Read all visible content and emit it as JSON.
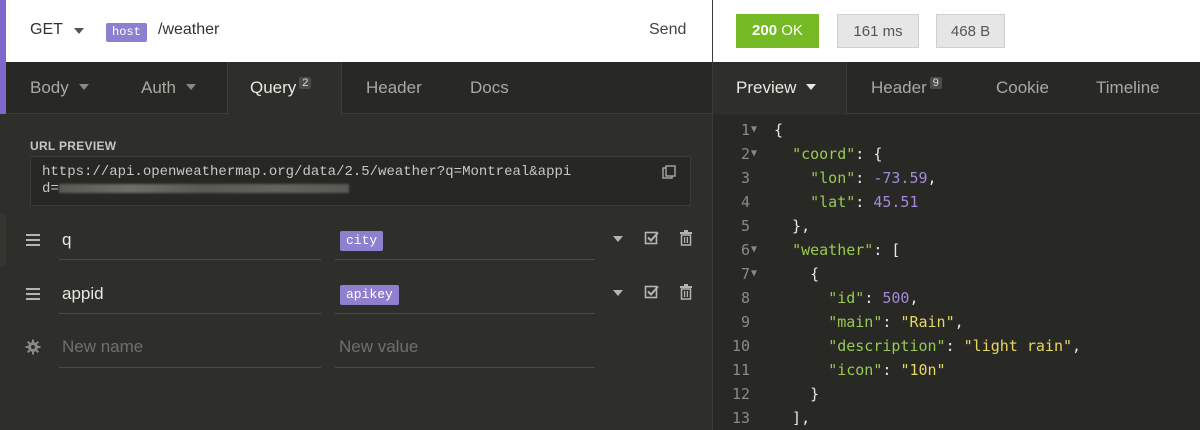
{
  "request": {
    "method": "GET",
    "host_tag": "host",
    "path": "/weather",
    "send_label": "Send"
  },
  "response": {
    "status_code": "200",
    "status_text": "OK",
    "time": "161 ms",
    "size": "468 B"
  },
  "request_tabs": [
    {
      "label": "Body"
    },
    {
      "label": "Auth"
    },
    {
      "label": "Query",
      "count": "2"
    },
    {
      "label": "Header"
    },
    {
      "label": "Docs"
    }
  ],
  "response_tabs": [
    {
      "label": "Preview"
    },
    {
      "label": "Header",
      "count": "9"
    },
    {
      "label": "Cookie"
    },
    {
      "label": "Timeline"
    }
  ],
  "url_preview": {
    "label": "URL PREVIEW",
    "line1": "https://api.openweathermap.org/data/2.5/weather?q=Montreal&appi",
    "line2": "d="
  },
  "params": [
    {
      "name": "q",
      "value_tag": "city"
    },
    {
      "name": "appid",
      "value_tag": "apikey"
    }
  ],
  "new_param": {
    "name_placeholder": "New name",
    "value_placeholder": "New value"
  },
  "code_lines": [
    {
      "n": "1",
      "text": "{"
    },
    {
      "n": "2",
      "text": "  \"coord\": {"
    },
    {
      "n": "3",
      "text": "    \"lon\": -73.59,"
    },
    {
      "n": "4",
      "text": "    \"lat\": 45.51"
    },
    {
      "n": "5",
      "text": "  },"
    },
    {
      "n": "6",
      "text": "  \"weather\": ["
    },
    {
      "n": "7",
      "text": "    {"
    },
    {
      "n": "8",
      "text": "      \"id\": 500,"
    },
    {
      "n": "9",
      "text": "      \"main\": \"Rain\","
    },
    {
      "n": "10",
      "text": "      \"description\": \"light rain\","
    },
    {
      "n": "11",
      "text": "      \"icon\": \"10n\""
    },
    {
      "n": "12",
      "text": "    }"
    },
    {
      "n": "13",
      "text": "  ],"
    }
  ],
  "colors": {
    "accent": "#7d69cb",
    "status_ok": "#75ba24",
    "tag": "#8f80cf",
    "json_key": "#98c954",
    "json_string": "#e6d85e",
    "json_number": "#a48ad9"
  }
}
